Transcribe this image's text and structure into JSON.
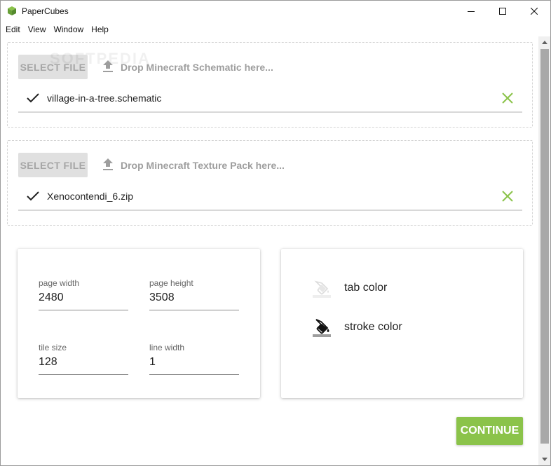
{
  "window": {
    "title": "PaperCubes",
    "controls": {
      "minimize": "minimize-icon",
      "maximize": "maximize-icon",
      "close": "close-icon"
    }
  },
  "menu": {
    "items": [
      "Edit",
      "View",
      "Window",
      "Help"
    ]
  },
  "schematic": {
    "button_label": "SELECT FILE",
    "drop_text": "Drop Minecraft Schematic here...",
    "file_name": "village-in-a-tree.schematic"
  },
  "texture_pack": {
    "button_label": "SELECT FILE",
    "drop_text": "Drop Minecraft Texture Pack here...",
    "file_name": "Xenocontendi_6.zip"
  },
  "settings": {
    "page_width": {
      "label": "page width",
      "value": "2480"
    },
    "page_height": {
      "label": "page height",
      "value": "3508"
    },
    "tile_size": {
      "label": "tile size",
      "value": "128"
    },
    "line_width": {
      "label": "line width",
      "value": "1"
    }
  },
  "colors": {
    "tab": {
      "label": "tab color",
      "swatch": "#eeeeee"
    },
    "stroke": {
      "label": "stroke color",
      "swatch": "#9e9e9e"
    }
  },
  "continue_label": "CONTINUE",
  "watermark": "SOFTPEDIA",
  "theme": {
    "accent": "#8bc34a",
    "remove_icon_color": "#8bc34a"
  }
}
